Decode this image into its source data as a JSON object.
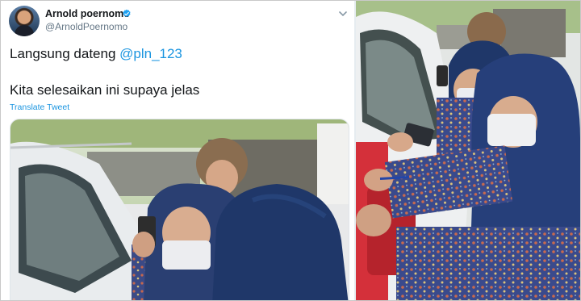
{
  "tweet": {
    "author_name": "Arnold poernomo",
    "handle": "@ArnoldPoernomo",
    "line1_text": "Langsung dateng ",
    "line1_mention": "@pln_123",
    "line2_text": "Kita selesaikan ini supaya jelas",
    "translate_label": "Translate Tweet"
  },
  "icons": {
    "verified": "verified-badge-icon",
    "caret": "chevron-down-icon"
  },
  "colors": {
    "link": "#1b95e0",
    "text": "#14171a",
    "muted": "#657786",
    "hijab": "#23396b"
  }
}
